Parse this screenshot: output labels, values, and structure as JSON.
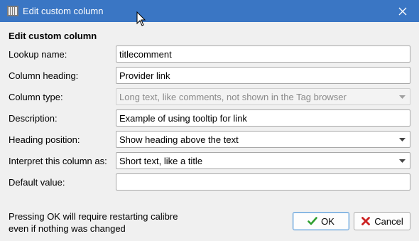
{
  "window": {
    "title": "Edit custom column",
    "title_icon": "calibre-library-icon",
    "close_icon": "close-icon",
    "titlebar_color": "#3a76c4"
  },
  "form": {
    "heading": "Edit custom column",
    "lookup_label": "Lookup name:",
    "lookup_value": "titlecomment",
    "column_heading_label": "Column heading:",
    "column_heading_value": "Provider link",
    "column_type_label": "Column type:",
    "column_type_value": "Long text, like comments, not shown in the Tag browser",
    "description_label": "Description:",
    "description_value": "Example of using tooltip for link",
    "heading_position_label": "Heading position:",
    "heading_position_value": "Show heading above the text",
    "interpret_label": "Interpret this column as:",
    "interpret_value": "Short text, like a title",
    "default_label": "Default value:",
    "default_value": ""
  },
  "footer": {
    "note_line1": "Pressing OK will require restarting calibre",
    "note_line2": "even if nothing was changed",
    "ok_label": "OK",
    "cancel_label": "Cancel",
    "ok_icon_color": "#2e9e2e",
    "cancel_icon_color": "#cc2222"
  }
}
